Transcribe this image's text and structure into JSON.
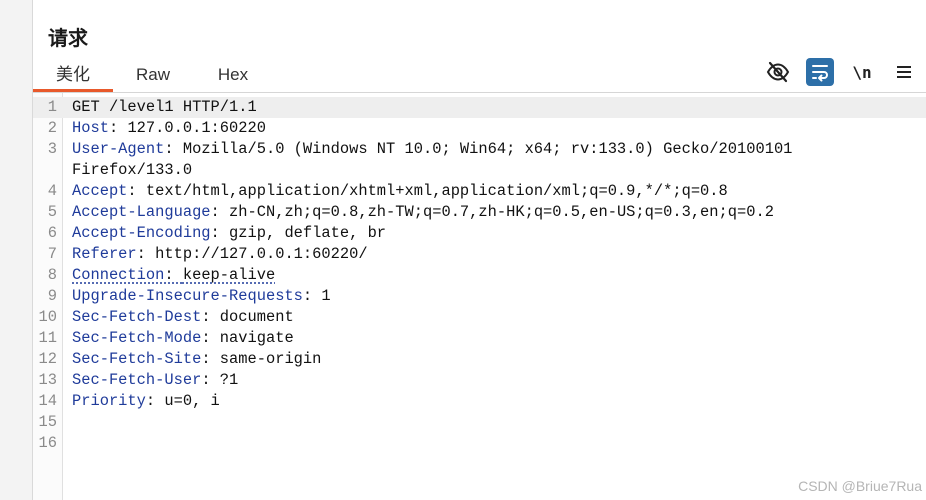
{
  "panel": {
    "title": "请求"
  },
  "tabs": [
    {
      "label": "美化",
      "active": true
    },
    {
      "label": "Raw",
      "active": false
    },
    {
      "label": "Hex",
      "active": false
    }
  ],
  "toolbar": {
    "items": [
      {
        "icon": "eye-slash-icon"
      },
      {
        "icon": "word-wrap-icon",
        "active": true
      },
      {
        "label": "\\n",
        "icon": "newline-toggle"
      },
      {
        "icon": "hamburger-menu-icon"
      }
    ]
  },
  "editor": {
    "request_line": "GET /level1 HTTP/1.1",
    "lines": [
      {
        "num": "1",
        "name": "",
        "value": "GET /level1 HTTP/1.1"
      },
      {
        "num": "2",
        "name": "Host",
        "value": "127.0.0.1:60220"
      },
      {
        "num": "3",
        "name": "User-Agent",
        "value": "Mozilla/5.0 (Windows NT 10.0; Win64; x64; rv:133.0) Gecko/20100101"
      },
      {
        "num": "",
        "name": "",
        "value": "Firefox/133.0"
      },
      {
        "num": "4",
        "name": "Accept",
        "value": "text/html,application/xhtml+xml,application/xml;q=0.9,*/*;q=0.8"
      },
      {
        "num": "5",
        "name": "Accept-Language",
        "value": "zh-CN,zh;q=0.8,zh-TW;q=0.7,zh-HK;q=0.5,en-US;q=0.3,en;q=0.2"
      },
      {
        "num": "6",
        "name": "Accept-Encoding",
        "value": "gzip, deflate, br"
      },
      {
        "num": "7",
        "name": "Referer",
        "value": "http://127.0.0.1:60220/"
      },
      {
        "num": "8",
        "name": "Connection",
        "value": "keep-alive"
      },
      {
        "num": "9",
        "name": "Upgrade-Insecure-Requests",
        "value": "1"
      },
      {
        "num": "10",
        "name": "Sec-Fetch-Dest",
        "value": "document"
      },
      {
        "num": "11",
        "name": "Sec-Fetch-Mode",
        "value": "navigate"
      },
      {
        "num": "12",
        "name": "Sec-Fetch-Site",
        "value": "same-origin"
      },
      {
        "num": "13",
        "name": "Sec-Fetch-User",
        "value": "?1"
      },
      {
        "num": "14",
        "name": "Priority",
        "value": "u=0, i"
      },
      {
        "num": "15",
        "name": "",
        "value": ""
      },
      {
        "num": "16",
        "name": "",
        "value": ""
      }
    ]
  },
  "watermark": "CSDN @Briue7Rua",
  "colors": {
    "accent": "#e8592b",
    "header_name": "#1f3b9a",
    "active_tool": "#2d6fa8"
  }
}
